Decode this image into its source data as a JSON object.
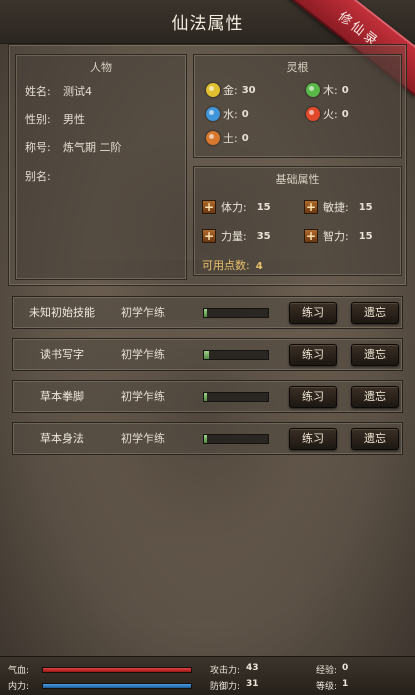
{
  "title": "仙法属性",
  "ribbon_text": "修仙录",
  "character": {
    "header": "人物",
    "rows": [
      {
        "key": "姓名:",
        "value": "测试4"
      },
      {
        "key": "性别:",
        "value": "男性"
      },
      {
        "key": "称号:",
        "value": "炼气期 二阶"
      },
      {
        "key": "别名:",
        "value": ""
      }
    ]
  },
  "spirit_root": {
    "header": "灵根",
    "elements": [
      {
        "label": "金:",
        "value": "30",
        "color": "#e0c030"
      },
      {
        "label": "木:",
        "value": "0",
        "color": "#5ab848"
      },
      {
        "label": "水:",
        "value": "0",
        "color": "#3f95d8"
      },
      {
        "label": "火:",
        "value": "0",
        "color": "#e04a2a"
      },
      {
        "label": "土:",
        "value": "0",
        "color": "#d6782e"
      }
    ]
  },
  "base_attributes": {
    "header": "基础属性",
    "stats": [
      {
        "label": "体力:",
        "value": "15"
      },
      {
        "label": "敏捷:",
        "value": "15"
      },
      {
        "label": "力量:",
        "value": "35"
      },
      {
        "label": "智力:",
        "value": "15"
      }
    ],
    "points_label": "可用点数:",
    "points_value": "4"
  },
  "skills": [
    {
      "name": "未知初始技能",
      "level": "初学乍练",
      "progress": 0.05,
      "practice": "练习",
      "forget": "遗忘"
    },
    {
      "name": "读书写字",
      "level": "初学乍练",
      "progress": 0.08,
      "practice": "练习",
      "forget": "遗忘"
    },
    {
      "name": "草本拳脚",
      "level": "初学乍练",
      "progress": 0.05,
      "practice": "练习",
      "forget": "遗忘"
    },
    {
      "name": "草本身法",
      "level": "初学乍练",
      "progress": 0.05,
      "practice": "练习",
      "forget": "遗忘"
    }
  ],
  "status": {
    "hp_label": "气血:",
    "mp_label": "内力:",
    "hp_fill": 1.0,
    "mp_fill": 1.0,
    "attack_label": "攻击力:",
    "attack_value": "43",
    "defense_label": "防御力:",
    "defense_value": "31",
    "exp_label": "经验:",
    "exp_value": "0",
    "level_label": "等级:",
    "level_value": "1"
  }
}
